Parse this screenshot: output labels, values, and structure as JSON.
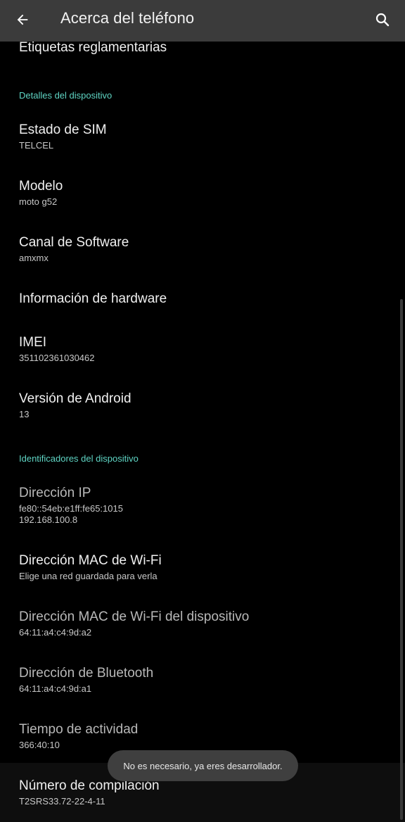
{
  "header": {
    "title": "Acerca del teléfono",
    "back_icon": "arrow-left-icon",
    "search_icon": "search-icon"
  },
  "top_item": {
    "title": "Etiquetas reglamentarias"
  },
  "sections": {
    "device_details": "Detalles del dispositivo",
    "device_identifiers": "Identificadores del dispositivo"
  },
  "items": {
    "sim": {
      "title": "Estado de SIM",
      "subtitle": "TELCEL"
    },
    "model": {
      "title": "Modelo",
      "subtitle": "moto g52"
    },
    "channel": {
      "title": "Canal de Software",
      "subtitle": "amxmx"
    },
    "hardware": {
      "title": "Información de hardware"
    },
    "imei": {
      "title": "IMEI",
      "subtitle": "351102361030462"
    },
    "android": {
      "title": "Versión de Android",
      "subtitle": "13"
    },
    "ip": {
      "title": "Dirección IP",
      "subtitle_line1": "fe80::54eb:e1ff:fe65:1015",
      "subtitle_line2": "192.168.100.8"
    },
    "wifi_mac": {
      "title": "Dirección MAC de Wi-Fi",
      "subtitle": "Elige una red guardada para verla"
    },
    "device_wifi_mac": {
      "title": "Dirección MAC de Wi-Fi del dispositivo",
      "subtitle": "64:11:a4:c4:9d:a2"
    },
    "bluetooth": {
      "title": "Dirección de Bluetooth",
      "subtitle": "64:11:a4:c4:9d:a1"
    },
    "uptime": {
      "title": "Tiempo de actividad",
      "subtitle": "366:40:10"
    },
    "build": {
      "title": "Número de compilación",
      "subtitle": "T2SRS33.72-22-4-11"
    }
  },
  "toast": {
    "text": "No es necesario, ya eres desarrollador."
  },
  "colors": {
    "accent": "#5fd5c4",
    "appbar": "#3b3b3b",
    "background": "#000000",
    "toast": "#3f3f3f"
  }
}
